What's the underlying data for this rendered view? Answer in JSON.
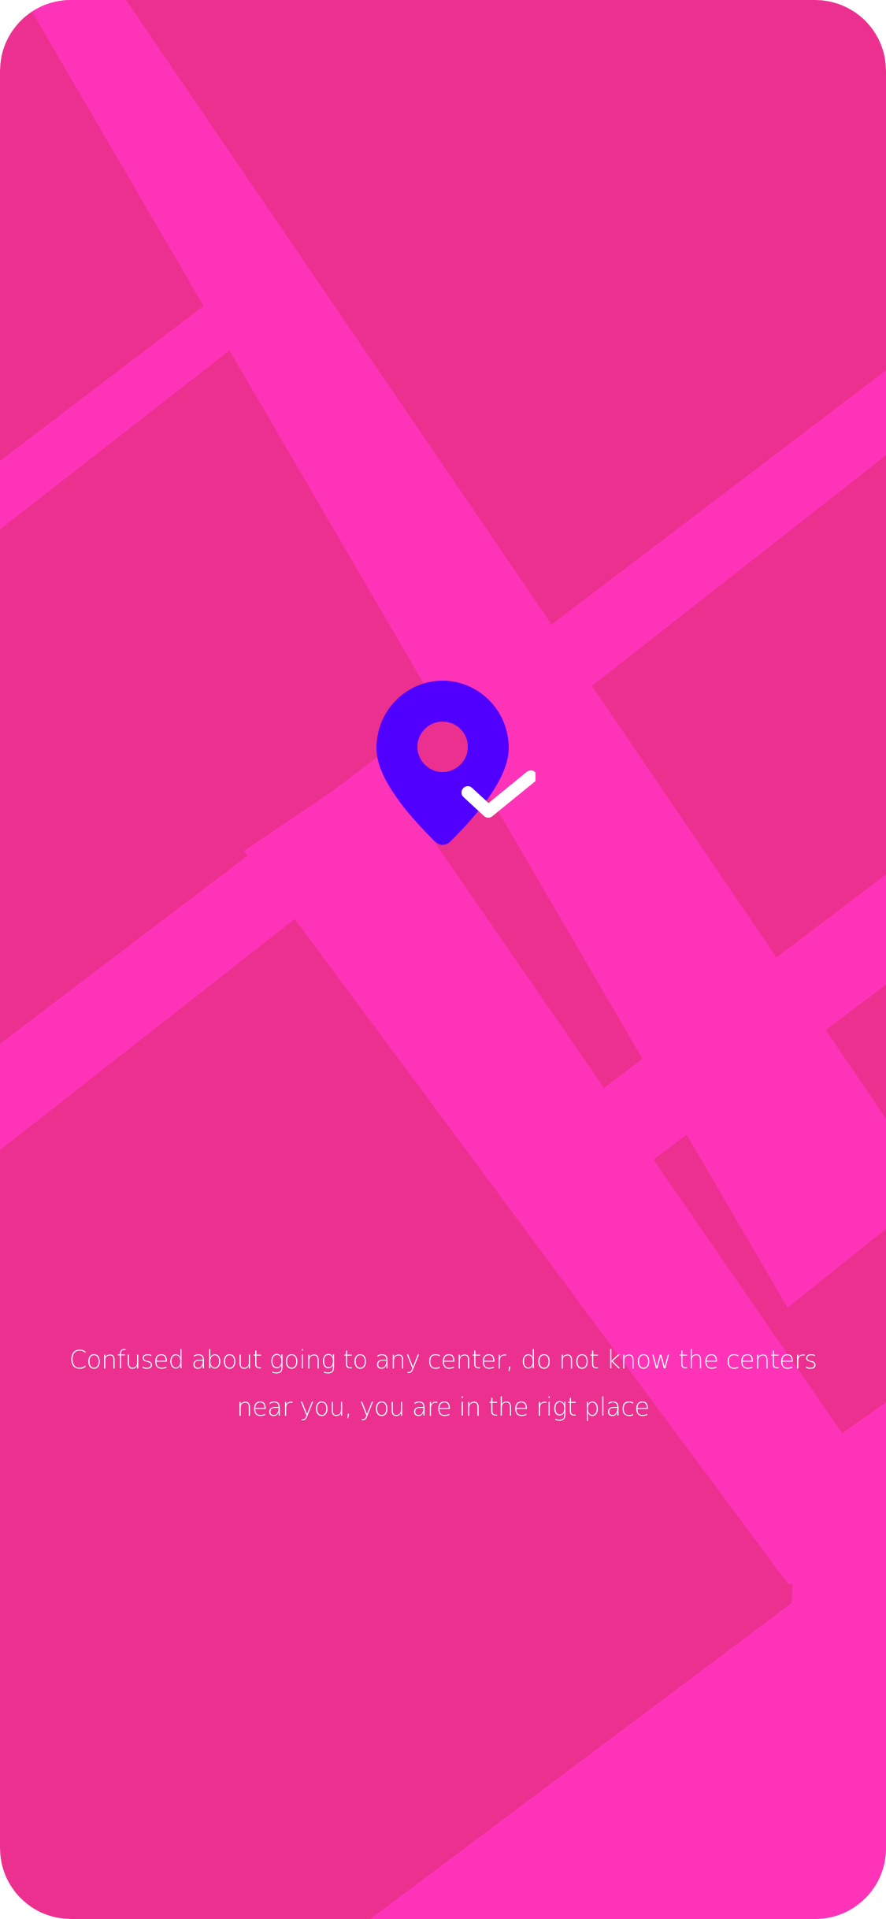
{
  "colors": {
    "background": "#EC3090",
    "roads": "#FF33B7",
    "pin": "#5000FF",
    "check": "#FFFFFF",
    "text": "#FFFFFF"
  },
  "illustration": {
    "icon": "location-pin-check-icon"
  },
  "onboarding": {
    "description": "Confused about going to any center, do not know the centers near you, you are in the rigt place"
  }
}
